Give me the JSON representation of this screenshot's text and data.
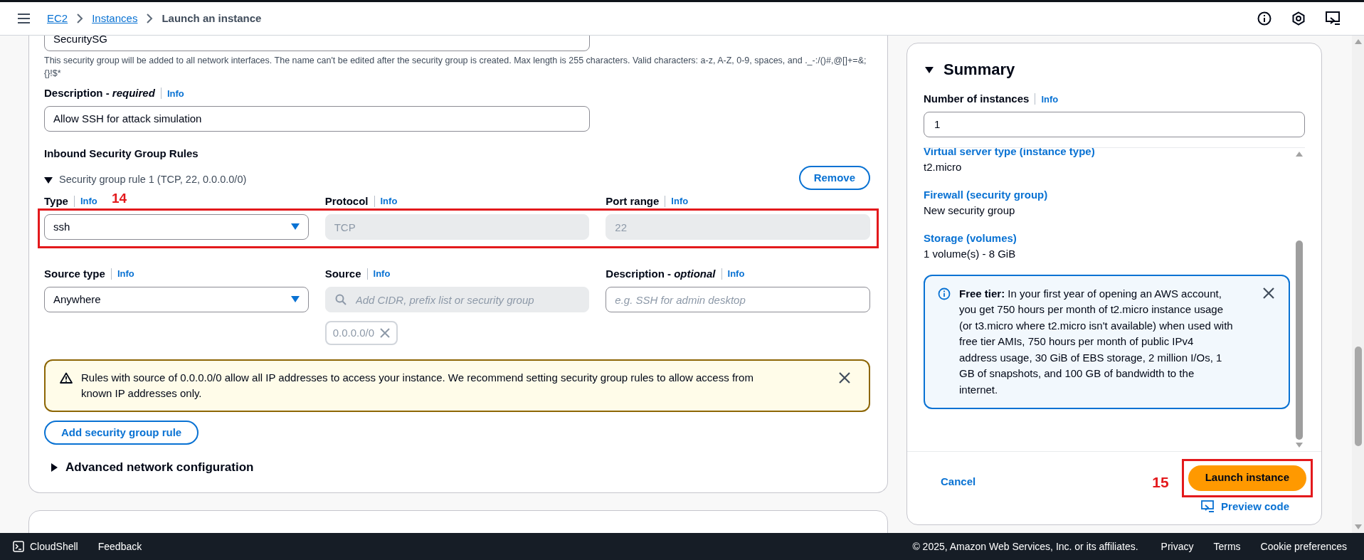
{
  "header": {
    "breadcrumbs": [
      {
        "label": "EC2",
        "link": true
      },
      {
        "label": "Instances",
        "link": true
      },
      {
        "label": "Launch an instance",
        "link": false
      }
    ]
  },
  "security_group": {
    "name_value": "SecuritySG",
    "name_hint": "This security group will be added to all network interfaces. The name can't be edited after the security group is created. Max length is 255 characters. Valid characters: a-z, A-Z, 0-9, spaces, and ._-:/()#,@[]+=&;{}!$*",
    "description_label": "Description - *required*",
    "description_info": "Info",
    "description_value": "Allow SSH for attack simulation"
  },
  "inbound": {
    "heading": "Inbound Security Group Rules",
    "rule": {
      "title": "Security group rule 1 (TCP, 22, 0.0.0.0/0)",
      "expanded": true,
      "remove_button": "Remove",
      "row1": [
        {
          "label": "Type",
          "info": "Info",
          "kind": "select",
          "value": "ssh",
          "disabled": false
        },
        {
          "label": "Protocol",
          "info": "Info",
          "kind": "input",
          "value": "TCP",
          "disabled": true
        },
        {
          "label": "Port range",
          "info": "Info",
          "kind": "input",
          "value": "22",
          "disabled": true
        }
      ],
      "row2": [
        {
          "label": "Source type",
          "info": "Info",
          "kind": "select",
          "value": "Anywhere",
          "disabled": false
        },
        {
          "label": "Source",
          "info": "Info",
          "kind": "search",
          "placeholder": "Add CIDR, prefix list or security group",
          "disabled": true,
          "chips": [
            "0.0.0.0/0"
          ]
        },
        {
          "label": "Description - *optional*",
          "info": "Info",
          "kind": "input",
          "placeholder": "e.g. SSH for admin desktop",
          "disabled": false
        }
      ]
    },
    "warning": "Rules with source of 0.0.0.0/0 allow all IP addresses to access your instance. We recommend setting security group rules to allow access from known IP addresses only.",
    "add_button": "Add security group rule"
  },
  "advanced": {
    "label": "Advanced network configuration",
    "expanded": false
  },
  "annotations": [
    {
      "label": "14"
    },
    {
      "label": "15"
    }
  ],
  "summary": {
    "title": "Summary",
    "expanded": true,
    "instances_label": "Number of instances",
    "instances_info": "Info",
    "instances_value": "1",
    "items": [
      {
        "label": "Virtual server type (instance type)",
        "value": "t2.micro"
      },
      {
        "label": "Firewall (security group)",
        "value": "New security group"
      },
      {
        "label": "Storage (volumes)",
        "value": "1 volume(s) - 8 GiB"
      }
    ],
    "free_tier": "**Free tier:** In your first year of opening an AWS account, you get 750 hours per month of t2.micro instance usage (or t3.micro where t2.micro isn't available) when used with free tier AMIs, 750 hours per month of public IPv4 address usage, 30 GiB of EBS storage, 2 million I/Os, 1 GB of snapshots, and 100 GB of bandwidth to the internet.",
    "cancel": "Cancel",
    "launch": "Launch instance",
    "preview": "Preview code"
  },
  "footer": {
    "left": [
      "CloudShell",
      "Feedback"
    ],
    "copyright": "© 2025, Amazon Web Services, Inc. or its affiliates.",
    "links": [
      "Privacy",
      "Terms",
      "Cookie preferences"
    ]
  }
}
